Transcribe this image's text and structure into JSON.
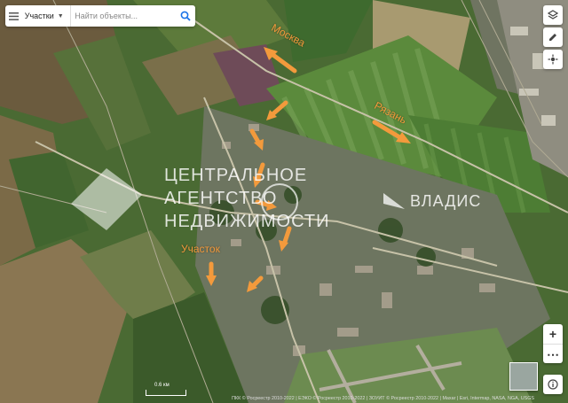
{
  "search": {
    "layer_label": "Участки",
    "placeholder": "Найти объекты..."
  },
  "labels": {
    "moscow": "Москва",
    "ryazan": "Рязань",
    "plot": "Участок"
  },
  "watermark": {
    "line1": "ЦЕНТРАЛЬНОЕ",
    "line2": "АГЕНТСТВО",
    "line3": "НЕДВИЖИМОСТИ",
    "brand": "ВЛАДИС"
  },
  "map": {
    "scale_label": "0.6 км",
    "attribution": "ПКК © Росреестр 2010-2022 | ЕЭКО © Росреестр 2010-2022 | ЗОУИТ © Росреестр 2010-2022 | Maxar | Esri, Intermap, NASA, NGA, USGS"
  },
  "icons": [
    "menu-icon",
    "search-icon",
    "layers-icon",
    "edit-icon",
    "location-icon",
    "info-icon"
  ],
  "colors": {
    "arrow": "#f39a3c",
    "search_accent": "#1a73e8"
  }
}
